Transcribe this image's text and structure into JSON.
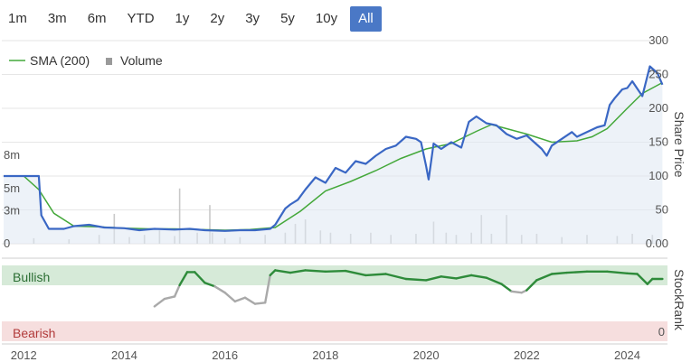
{
  "range_selector": {
    "buttons": [
      "1m",
      "3m",
      "6m",
      "YTD",
      "1y",
      "2y",
      "3y",
      "5y",
      "10y",
      "All"
    ],
    "selected": "All"
  },
  "colors": {
    "price": "#3a67c4",
    "sma": "#44a83a",
    "volume": "#c9c9c9",
    "bullish_band": "#d6ead8",
    "bearish_band": "#f6dede",
    "stockrank_high": "#2e8b3a",
    "stockrank_low": "#a9a9a9",
    "active_button": "#4a78c6"
  },
  "chart_data": {
    "type": "line",
    "legend": {
      "items": [
        "SMA (200)",
        "Volume"
      ],
      "position": "top-left"
    },
    "x_ticks": [
      "2012",
      "2014",
      "2016",
      "2018",
      "2020",
      "2022",
      "2024"
    ],
    "x_range": [
      2011.6,
      2024.8
    ],
    "price_axis": {
      "label": "Share Price",
      "ticks": [
        "300",
        "250",
        "200",
        "150",
        "100",
        "50",
        "0.00"
      ],
      "range": [
        0,
        300
      ]
    },
    "volume_axis": {
      "ticks": [
        "8m",
        "5m",
        "3m",
        "0"
      ],
      "range": [
        0,
        8
      ]
    },
    "stockrank_axis": {
      "label": "StockRank",
      "ticks": [
        "0"
      ],
      "bands": [
        "Bullish",
        "Bearish"
      ],
      "range": [
        0,
        100
      ]
    },
    "series": [
      {
        "name": "Price",
        "x": [
          2011.6,
          2012.0,
          2012.3,
          2012.35,
          2012.5,
          2012.8,
          2013.0,
          2013.3,
          2013.6,
          2014.0,
          2014.3,
          2014.6,
          2015.0,
          2015.3,
          2015.6,
          2016.0,
          2016.3,
          2016.6,
          2016.9,
          2017.0,
          2017.2,
          2017.3,
          2017.45,
          2017.6,
          2017.8,
          2018.0,
          2018.2,
          2018.4,
          2018.6,
          2018.8,
          2019.0,
          2019.2,
          2019.4,
          2019.6,
          2019.8,
          2019.9,
          2020.0,
          2020.05,
          2020.15,
          2020.3,
          2020.5,
          2020.7,
          2020.85,
          2021.0,
          2021.2,
          2021.4,
          2021.6,
          2021.8,
          2022.0,
          2022.15,
          2022.3,
          2022.4,
          2022.5,
          2022.7,
          2022.9,
          2023.0,
          2023.2,
          2023.4,
          2023.55,
          2023.65,
          2023.75,
          2023.9,
          2024.0,
          2024.1,
          2024.3,
          2024.45,
          2024.6,
          2024.7
        ],
        "values": [
          100,
          100,
          100,
          42,
          22,
          22,
          26,
          28,
          24,
          23,
          20,
          22,
          21,
          22,
          20,
          19,
          20,
          20,
          22,
          28,
          52,
          58,
          65,
          80,
          98,
          90,
          112,
          105,
          122,
          118,
          130,
          140,
          145,
          158,
          155,
          150,
          115,
          95,
          148,
          140,
          150,
          142,
          180,
          188,
          178,
          175,
          162,
          155,
          160,
          150,
          140,
          130,
          145,
          155,
          165,
          158,
          165,
          172,
          175,
          205,
          215,
          228,
          230,
          240,
          218,
          262,
          252,
          235
        ]
      },
      {
        "name": "SMA (200)",
        "x": [
          2011.6,
          2012.0,
          2012.3,
          2012.6,
          2013.0,
          2013.5,
          2014.0,
          2014.5,
          2015.0,
          2015.5,
          2016.0,
          2016.5,
          2017.0,
          2017.5,
          2018.0,
          2018.5,
          2019.0,
          2019.5,
          2020.0,
          2020.5,
          2021.0,
          2021.3,
          2021.6,
          2022.0,
          2022.5,
          2023.0,
          2023.3,
          2023.6,
          2024.0,
          2024.3,
          2024.7
        ],
        "values": [
          100,
          100,
          80,
          45,
          26,
          25,
          23,
          22,
          22,
          21,
          20,
          21,
          24,
          48,
          78,
          92,
          108,
          126,
          140,
          148,
          166,
          176,
          170,
          162,
          150,
          152,
          158,
          170,
          200,
          222,
          238
        ]
      },
      {
        "name": "StockRank",
        "x": [
          2014.6,
          2014.8,
          2015.0,
          2015.1,
          2015.25,
          2015.4,
          2015.6,
          2015.8,
          2016.0,
          2016.2,
          2016.4,
          2016.6,
          2016.8,
          2016.9,
          2017.0,
          2017.3,
          2017.6,
          2018.0,
          2018.4,
          2018.8,
          2019.2,
          2019.6,
          2020.0,
          2020.3,
          2020.6,
          2020.9,
          2021.2,
          2021.5,
          2021.7,
          2021.9,
          2022.0,
          2022.2,
          2022.5,
          2022.8,
          2023.2,
          2023.6,
          2024.0,
          2024.2,
          2024.4,
          2024.5,
          2024.7
        ],
        "values": [
          40,
          52,
          56,
          74,
          95,
          95,
          78,
          72,
          62,
          48,
          54,
          44,
          46,
          90,
          98,
          94,
          98,
          96,
          97,
          90,
          92,
          84,
          82,
          88,
          85,
          90,
          86,
          76,
          64,
          62,
          66,
          82,
          92,
          94,
          96,
          96,
          93,
          92,
          76,
          84,
          84
        ]
      },
      {
        "name": "Volume",
        "x": [
          2012.2,
          2012.9,
          2013.5,
          2013.8,
          2014.1,
          2014.4,
          2014.7,
          2015.0,
          2015.1,
          2015.45,
          2015.7,
          2015.75,
          2016.0,
          2016.3,
          2016.8,
          2017.2,
          2017.4,
          2017.6,
          2017.9,
          2018.1,
          2018.5,
          2018.9,
          2019.3,
          2019.8,
          2020.15,
          2020.4,
          2020.6,
          2020.9,
          2021.1,
          2021.3,
          2021.6,
          2021.9,
          2022.2,
          2022.7,
          2023.2,
          2023.8,
          2024.1,
          2024.5
        ],
        "values": [
          0.5,
          0.4,
          0.8,
          2.7,
          0.6,
          0.8,
          1.2,
          0.7,
          5.0,
          1.0,
          3.5,
          1.0,
          0.5,
          0.6,
          0.8,
          1.0,
          1.8,
          2.2,
          1.2,
          1.0,
          0.9,
          1.0,
          0.8,
          0.9,
          2.0,
          1.0,
          0.8,
          1.0,
          2.6,
          0.9,
          2.6,
          0.8,
          0.9,
          0.6,
          0.8,
          0.7,
          0.9,
          0.8
        ]
      }
    ]
  }
}
